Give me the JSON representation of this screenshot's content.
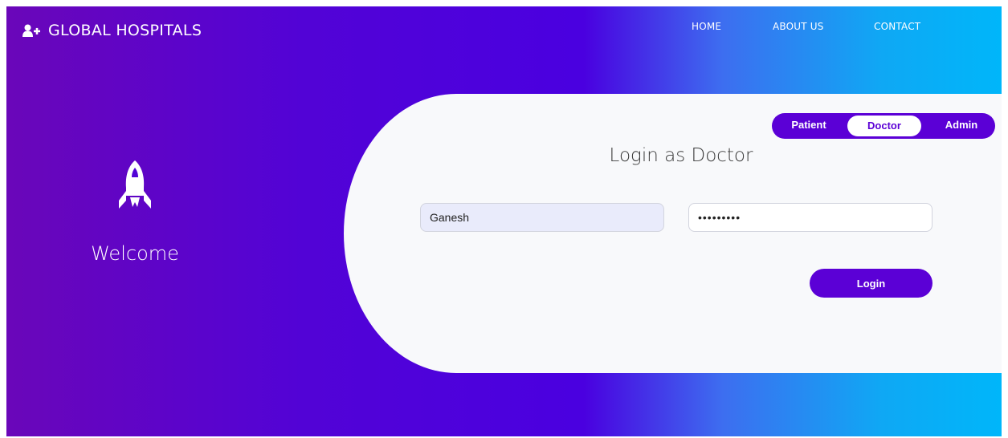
{
  "header": {
    "brand": "GLOBAL HOSPITALS",
    "brand_icon": "user-plus-icon",
    "nav": [
      "HOME",
      "ABOUT US",
      "CONTACT"
    ]
  },
  "welcome": {
    "icon": "rocket-icon",
    "text": "Welcome"
  },
  "login": {
    "roles": [
      "Patient",
      "Doctor",
      "Admin"
    ],
    "active_role": "Doctor",
    "title": "Login as Doctor",
    "username_value": "Ganesh",
    "password_value": "Ganesh@12",
    "button_label": "Login"
  },
  "colors": {
    "accent": "#5b00d6",
    "gradient_start": "#6a06b9",
    "gradient_mid": "#4a00e0",
    "gradient_end": "#00b6fa",
    "card_bg": "#f8f9fb"
  }
}
